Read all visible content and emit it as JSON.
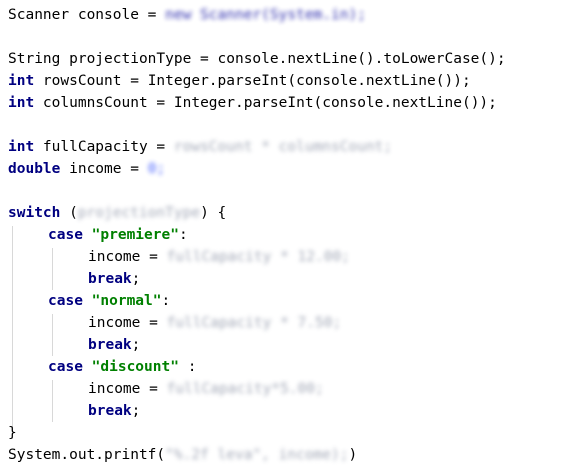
{
  "code": {
    "l1_type": "Scanner",
    "l1_var": " console = ",
    "l1_blur": "new Scanner(System.in);",
    "l3": "String projectionType = console.nextLine().toLowerCase();",
    "l4_kw": "int",
    "l4_rest": " rowsCount = Integer.parseInt(console.nextLine());",
    "l5_kw": "int",
    "l5_rest": " columnsCount = Integer.parseInt(console.nextLine());",
    "l7_kw": "int",
    "l7_rest": " fullCapacity = ",
    "l7_blur": "rowsCount * columnsCount;",
    "l8_kw": "double",
    "l8_rest": " income = ",
    "l8_blur": "0;",
    "l10_kw": "switch",
    "l10_open": " (",
    "l10_blur": "projectionType",
    "l10_close": ") {",
    "case_kw": "case",
    "case1_str": "\"premiere\"",
    "case1_tail": ":",
    "income_label": "income = ",
    "case1_blur": "fullCapacity * 12.00;",
    "break_kw": "break",
    "semicolon": ";",
    "case2_str": "\"normal\"",
    "case2_tail": ":",
    "case2_blur": "fullCapacity * 7.50;",
    "case3_str": "\"discount\"",
    "case3_tail": " :",
    "case3_blur": "fullCapacity*5.00;",
    "close_brace": "}",
    "printf_start": "System.out.printf(",
    "printf_blur": "\"%.2f leva\", income);",
    "printf_end": ")"
  }
}
